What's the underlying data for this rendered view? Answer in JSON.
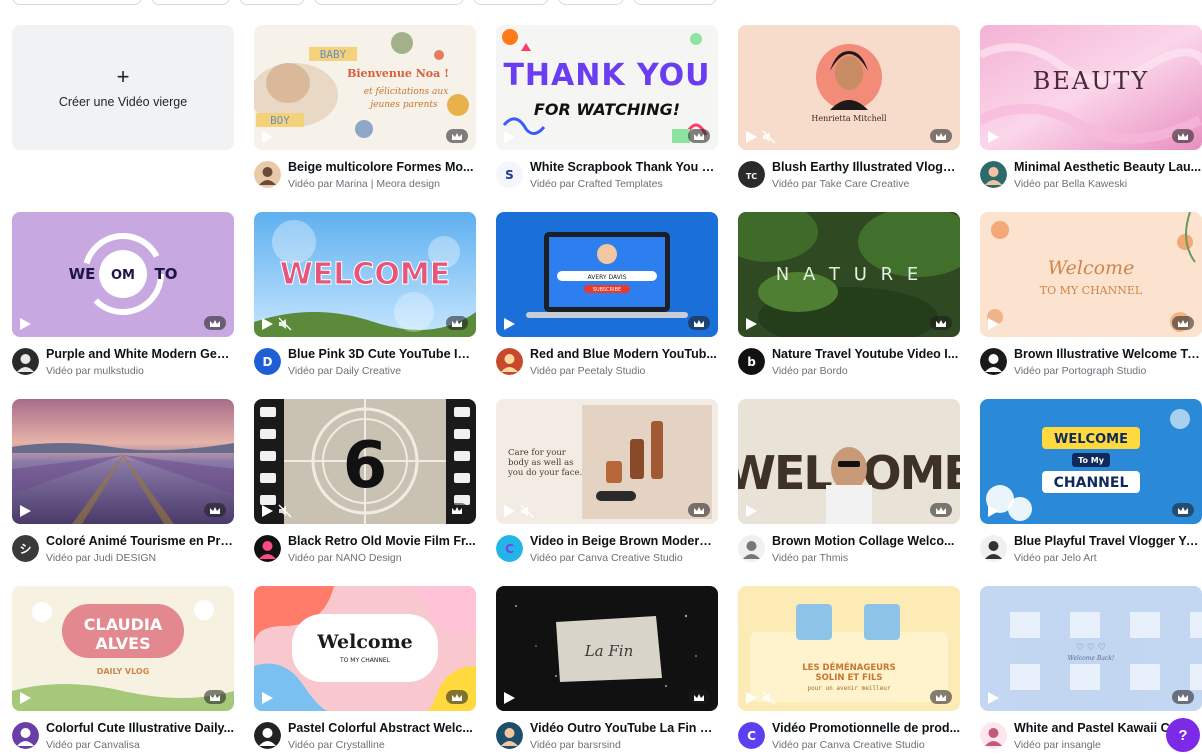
{
  "create_tile": {
    "plus": "+",
    "label": "Créer une Vidéo vierge"
  },
  "help": {
    "label": "?"
  },
  "templates": [
    {
      "title": "Beige multicolore Formes Mo...",
      "byline": "Vidéo par Marina | Meora design",
      "art": "baby",
      "art_text": [
        "BABY",
        "BOY",
        "Bienvenue Noa !",
        "et félicitations aux",
        "jeunes parents"
      ]
    },
    {
      "title": "White Scrapbook Thank You fo...",
      "byline": "Vidéo par Crafted Templates",
      "art": "thanks",
      "art_text": [
        "THANK YOU",
        "FOR WATCHING!"
      ]
    },
    {
      "title": "Blush Earthy Illustrated Vlogg...",
      "byline": "Vidéo par Take Care Creative",
      "art": "blush",
      "art_text": [
        "Henrietta Mitchell"
      ]
    },
    {
      "title": "Minimal Aesthetic Beauty Lau...",
      "byline": "Vidéo par Bella Kaweski",
      "art": "beauty",
      "art_text": [
        "BEAUTY"
      ]
    },
    {
      "title": "Purple and White Modern Geo...",
      "byline": "Vidéo par mulkstudio",
      "art": "purple",
      "art_text": [
        "WE",
        "OM",
        "TO"
      ]
    },
    {
      "title": "Blue Pink 3D Cute YouTube Int...",
      "byline": "Vidéo par Daily Creative",
      "art": "bubbles",
      "art_text": [
        "WELCOME"
      ]
    },
    {
      "title": "Red and Blue Modern YouTub...",
      "byline": "Vidéo par Peetaly Studio",
      "art": "laptop",
      "art_text": [
        "AVERY DAVIS",
        "SUBSCRIBE"
      ]
    },
    {
      "title": "Nature Travel Youtube Video I...",
      "byline": "Vidéo par Bordo",
      "art": "nature",
      "art_text": [
        "N A T U R E"
      ]
    },
    {
      "title": "Brown Illustrative Welcome To...",
      "byline": "Vidéo par Portograph Studio",
      "art": "floral",
      "art_text": [
        "Welcome",
        "TO MY CHANNEL"
      ]
    },
    {
      "title": "Coloré Animé Tourisme en Pro...",
      "byline": "Vidéo par Judi DESIGN",
      "art": "lavender",
      "art_text": []
    },
    {
      "title": "Black Retro Old Movie Film Fr...",
      "byline": "Vidéo par NANO Design",
      "art": "film",
      "art_text": [
        "6"
      ]
    },
    {
      "title": "Video in Beige Brown Modern ...",
      "byline": "Vidéo par Canva Creative Studio",
      "art": "skincare",
      "art_text": [
        "Care for your",
        "body as well as",
        "you do your face."
      ]
    },
    {
      "title": "Brown Motion Collage Welco...",
      "byline": "Vidéo par Thmis",
      "art": "collage",
      "art_text": [
        "WELCOME"
      ]
    },
    {
      "title": "Blue Playful Travel Vlogger Yo...",
      "byline": "Vidéo par Jelo Art",
      "art": "travel",
      "art_text": [
        "WELCOME",
        "To My",
        "CHANNEL"
      ]
    },
    {
      "title": "Colorful Cute Illustrative Daily...",
      "byline": "Vidéo par Canvalisa",
      "art": "claudia",
      "art_text": [
        "CLAUDIA",
        "ALVES",
        "DAILY VLOG"
      ]
    },
    {
      "title": "Pastel Colorful Abstract Welc...",
      "byline": "Vidéo par Crystalline",
      "art": "pastel",
      "art_text": [
        "Welcome",
        "TO MY CHANNEL"
      ]
    },
    {
      "title": "Vidéo Outro YouTube La Fin Vi...",
      "byline": "Vidéo par barsrsind",
      "art": "lafin",
      "art_text": [
        "La Fin"
      ]
    },
    {
      "title": "Vidéo Promotionnelle de prod...",
      "byline": "Vidéo par Canva Creative Studio",
      "art": "movers",
      "art_text": [
        "LES DÉMÉNAGEURS",
        "SOLIN ET FILS",
        "pour un avenir meilleur"
      ]
    },
    {
      "title": "White and Pastel Kawaii Cu...",
      "byline": "Vidéo par insangle",
      "art": "gingham",
      "art_text": [
        "Welcome Back!"
      ]
    }
  ]
}
